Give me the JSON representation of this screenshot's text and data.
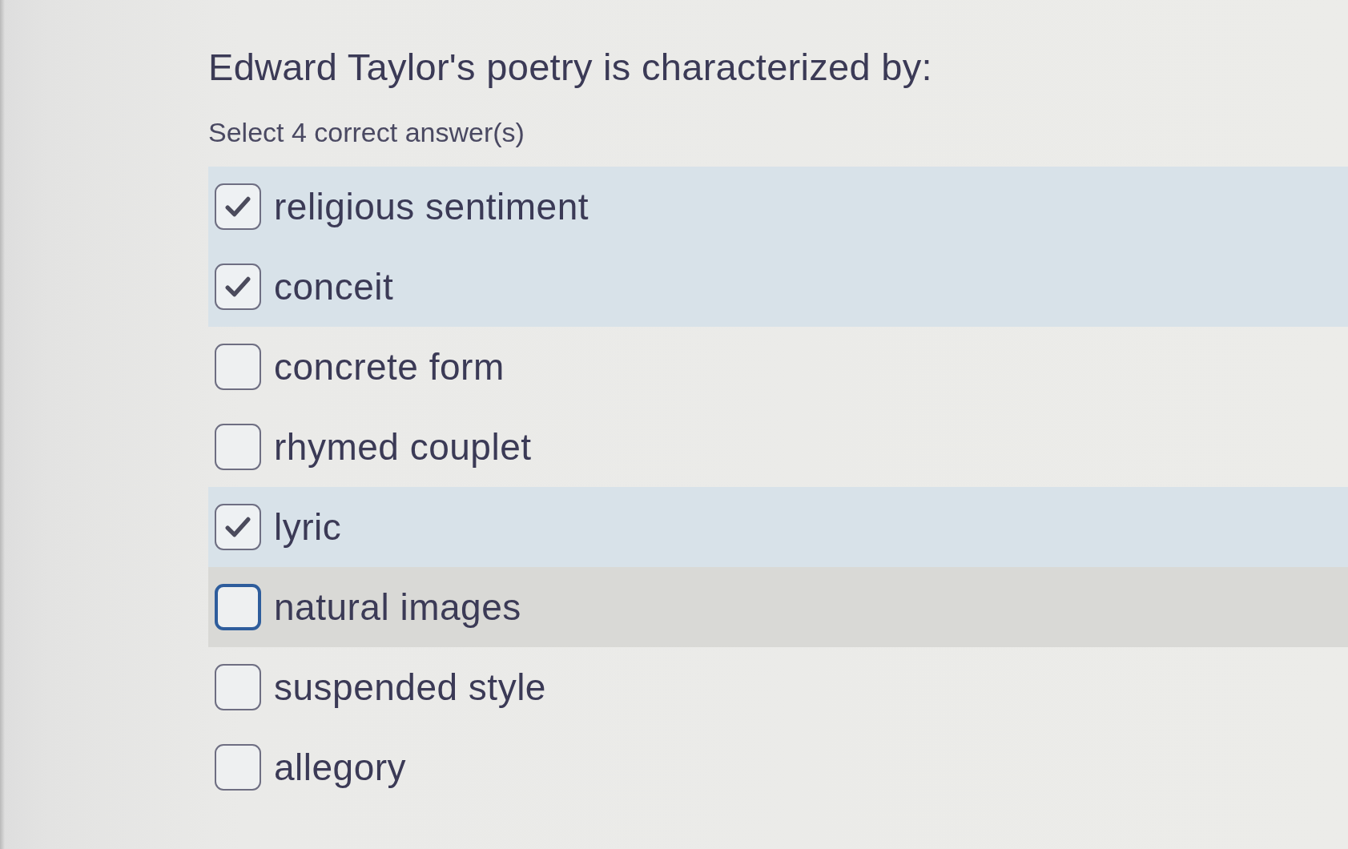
{
  "question": {
    "title": "Edward Taylor's poetry is characterized by:",
    "instruction": "Select 4 correct answer(s)"
  },
  "options": [
    {
      "label": "religious sentiment",
      "checked": true,
      "focused": false
    },
    {
      "label": "conceit",
      "checked": true,
      "focused": false
    },
    {
      "label": "concrete form",
      "checked": false,
      "focused": false
    },
    {
      "label": "rhymed couplet",
      "checked": false,
      "focused": false
    },
    {
      "label": "lyric",
      "checked": true,
      "focused": false
    },
    {
      "label": "natural images",
      "checked": false,
      "focused": true
    },
    {
      "label": "suspended style",
      "checked": false,
      "focused": false
    },
    {
      "label": "allegory",
      "checked": false,
      "focused": false
    }
  ]
}
